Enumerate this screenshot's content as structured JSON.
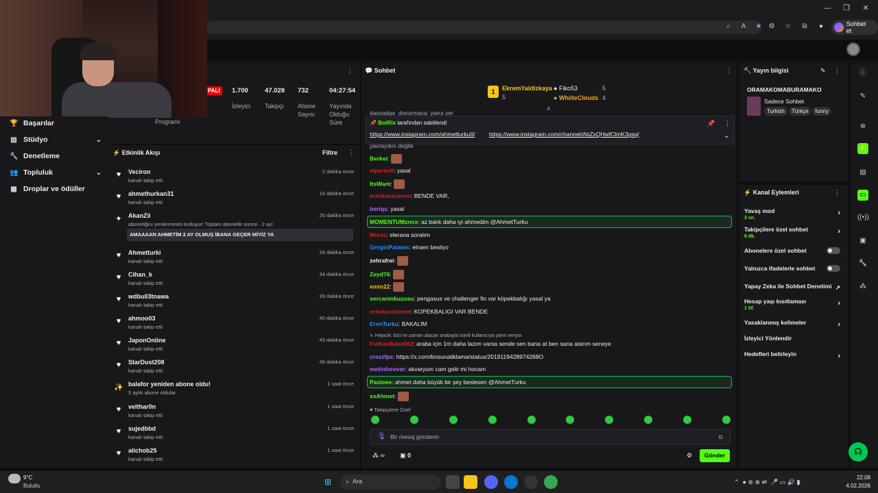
{
  "browser": {
    "copilot_label": "Sohbet et",
    "win_min": "—",
    "win_max": "❐",
    "win_close": "✕"
  },
  "sidebar": {
    "items": [
      {
        "label": "Başarılar",
        "icon": "trophy-icon",
        "expandable": false
      },
      {
        "label": "Stüdyo",
        "icon": "video-icon",
        "expandable": true
      },
      {
        "label": "Denetleme",
        "icon": "wrench-icon",
        "expandable": false
      },
      {
        "label": "Topluluk",
        "icon": "community-icon",
        "expandable": true
      },
      {
        "label": "Droplar ve ödüller",
        "icon": "gift-icon",
        "expandable": false
      }
    ]
  },
  "stats": {
    "badge": "PALI",
    "programi_label": "Programı",
    "program_partial": "u\nu",
    "items": [
      {
        "value": "1.700",
        "label": "İzleyici"
      },
      {
        "value": "47.028",
        "label": "Takipçi"
      },
      {
        "value": "732",
        "label": "Abone\nSayısı"
      },
      {
        "value": "04:27:54",
        "label": "Yayında\nOlduğu\nSüre"
      }
    ]
  },
  "activity": {
    "title": "Etkinlik Akışı",
    "filter": "Filtre",
    "akan_message": "AMAAAAN AHMETİM 2 AY OLMUŞ İBANA GEÇER MİYİZ YA",
    "rows": [
      {
        "name": "Veciron",
        "sub": "kanalı takip etti",
        "time": "2 dakika önce",
        "icon": "heart-icon"
      },
      {
        "name": "ahmethurkan31",
        "sub": "kanalı takip etti",
        "time": "16 dakika önce",
        "icon": "heart-icon"
      },
      {
        "name": "AkanZii",
        "sub": "aboneliğini yenilemesini kutluyor! Toplam abonelik süresi - 2 ay!",
        "time": "26 dakika önce",
        "icon": "star-icon"
      },
      {
        "name": "Ahmetturki",
        "sub": "kanalı takip etti",
        "time": "28 dakika önce",
        "icon": "heart-icon"
      },
      {
        "name": "Cihan_k",
        "sub": "kanalı takip etti",
        "time": "34 dakika önce",
        "icon": "heart-icon"
      },
      {
        "name": "wdbull3tnawa",
        "sub": "kanalı takip etti",
        "time": "39 dakika önce",
        "icon": "heart-icon"
      },
      {
        "name": "ahmoo03",
        "sub": "kanalı takip etti",
        "time": "40 dakika önce",
        "icon": "heart-icon"
      },
      {
        "name": "JaponOnline",
        "sub": "kanalı takip etti",
        "time": "43 dakika önce",
        "icon": "heart-icon"
      },
      {
        "name": "StarDust208",
        "sub": "kanalı takip etti",
        "time": "46 dakika önce",
        "icon": "heart-icon"
      },
      {
        "name": "balafor yeniden abone oldu!",
        "sub": "5 aylık abone oldular",
        "time": "1 saat önce",
        "icon": "sparkle-icon"
      },
      {
        "name": "velthar0n",
        "sub": "kanalı takip etti",
        "time": "1 saat önce",
        "icon": "heart-icon"
      },
      {
        "name": "sujedbbd",
        "sub": "kanalı takip etti",
        "time": "1 saat önce",
        "icon": "heart-icon"
      },
      {
        "name": "alichob25",
        "sub": "kanalı takip etti",
        "time": "1 saat önce",
        "icon": "heart-icon"
      }
    ]
  },
  "chat": {
    "title": "Sohbet",
    "leaders": [
      {
        "name": "EkremYaldizkaya",
        "count": "5",
        "color": "#f5c518"
      },
      {
        "name": "Fiko53",
        "count": "5",
        "color": "#efeff1"
      },
      {
        "name": "WhiiteClouds",
        "count": "4",
        "color": "#f5a623"
      }
    ],
    "leader_rank": "1",
    "pinned_by_name": "BotRix",
    "pinned_by_suffix": "tarafından sabitlendi",
    "pinned_link1": "https://www.instagram.com/ahmetturku0/",
    "pinned_link2": "https://www.instagram.com/channel/AbZxQHwfClmK3gsq/",
    "partial_top": "dassadqa_doxurmaca: yarra yer",
    "partial_under": "yavrayıkın değile",
    "messages": [
      {
        "user": "Berkei",
        "color": "#53fc18",
        "text": ""
      },
      {
        "user": "alperen0",
        "color": "#e91916",
        "text": "yasal"
      },
      {
        "user": "ItsWant",
        "color": "#53fc18",
        "text": ""
      },
      {
        "user": "erenkaracimen",
        "color": "#e91916",
        "text": "BENDE VAR,"
      },
      {
        "user": "beriqx",
        "color": "#a970ff",
        "text": "yasal"
      },
      {
        "user": "MOMENTUMznnx",
        "color": "#53fc18",
        "text": "az balık daha iyi ahmedim @AhmetTurku"
      },
      {
        "user": "Murez",
        "color": "#e91916",
        "text": "elerana soralım"
      },
      {
        "user": "GerginPatates",
        "color": "#1e90ff",
        "text": "elraen besliyo"
      },
      {
        "user": "zehrafrei",
        "color": "#efeff1",
        "text": ""
      },
      {
        "user": "Zeyd76",
        "color": "#53fc18",
        "text": ""
      },
      {
        "user": "emin22",
        "color": "#f5c518",
        "text": ""
      },
      {
        "user": "sercaninkuzusu",
        "color": "#53fc18",
        "text": "pengasus ve challenger fin var köpekbalığı yasal ya"
      },
      {
        "user": "erenkaracimen",
        "color": "#e91916",
        "text": "KOPEKBALIGI VAR BENDE"
      },
      {
        "user": "ErenTurku",
        "color": "#1e90ff",
        "text": "BAKALIM"
      },
      {
        "user": "",
        "color": "#adadb8",
        "text": "↳ Hejacik: bizi ne zaman alacan arabayla isimli kullanıcıya yanıt veriyor"
      },
      {
        "user": "FurkanBaba062",
        "color": "#e91916",
        "text": "araba için 1m daha lazım varsa sende sen bana at ben sana atarım seneye"
      },
      {
        "user": "crezzfps",
        "color": "#a970ff",
        "text": "https://x.com/bosunatiklama/status/2019119428974268O"
      },
      {
        "user": "metinforever",
        "color": "#a970ff",
        "text": "akvaryum cam gelir mi hocam"
      },
      {
        "user": "Pasteee",
        "color": "#53fc18",
        "text": "ahmet daha büyük bir şey beslesen @AhmetTurku"
      },
      {
        "user": "xsAhmet",
        "color": "#53fc18",
        "text": ""
      }
    ],
    "followers_only": "Takipçilere Özel",
    "input_placeholder": "Bir mesaj gönderin",
    "send_label": "Gönder",
    "bottom_count": "0"
  },
  "stream_info": {
    "title": "Yayın bilgisi",
    "stream_title": "ORAMAKOMABURAMAKO",
    "category": "Sadece Sohbet",
    "tags": [
      "Turkish",
      "Türkçe",
      "funny"
    ]
  },
  "channel_actions": {
    "title": "Kanal Eylemleri",
    "rows": [
      {
        "label": "Yavaş mod",
        "sub": "3 sn.",
        "control": "chevron"
      },
      {
        "label": "Takipçilere özel sohbet",
        "sub": "6 dk.",
        "control": "chevron"
      },
      {
        "label": "Abonelere özel sohbet",
        "sub": "",
        "control": "toggle"
      },
      {
        "label": "Yalnızca ifadelerle sohbet",
        "sub": "",
        "control": "toggle"
      },
      {
        "label": "Yapay Zeka ile Sohbet Denetimi",
        "sub": "",
        "control": "external"
      },
      {
        "label": "Hesap yaşı kısıtlaması",
        "sub": "1 hf.",
        "control": "chevron"
      },
      {
        "label": "Yasaklanmış kelimeler",
        "sub": "",
        "control": "chevron"
      },
      {
        "label": "İzleyici Yönlendir",
        "sub": "",
        "control": "none"
      },
      {
        "label": "Hedefleri belirleyin",
        "sub": "",
        "control": "chevron"
      }
    ]
  },
  "taskbar": {
    "weather_temp": "9°C",
    "weather_desc": "Bulutlu",
    "search_placeholder": "Ara",
    "time": "22:08",
    "date": "4.02.2026"
  }
}
